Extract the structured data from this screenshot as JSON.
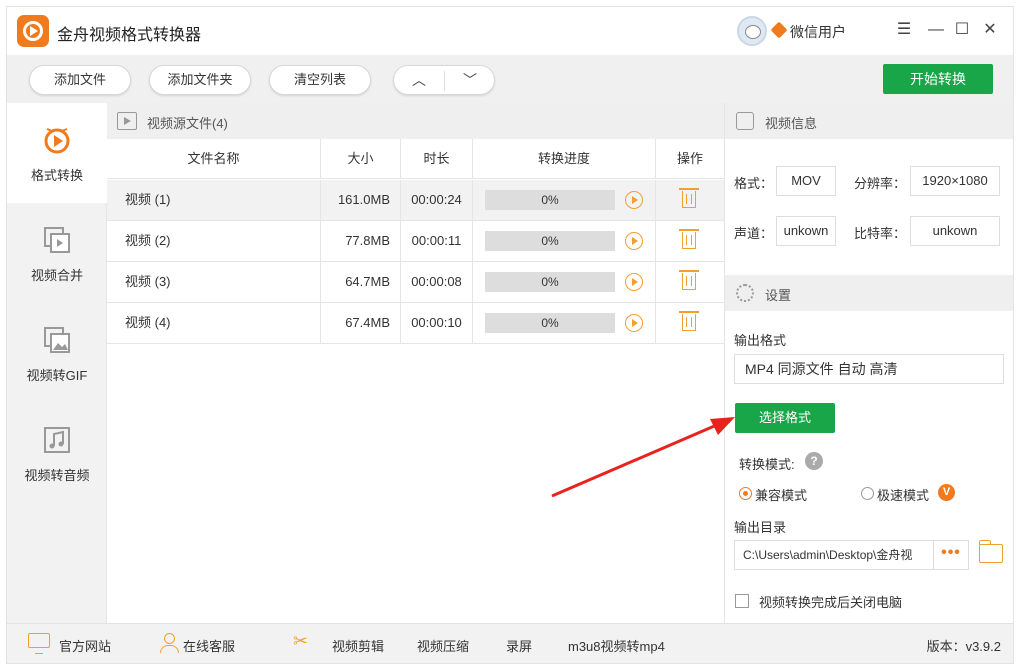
{
  "app": {
    "title": "金舟视频格式转换器",
    "user_name": "微信用户"
  },
  "window_controls": {
    "menu": "☰",
    "minimize": "—",
    "maximize": "☐",
    "close": "✕"
  },
  "toolbar": {
    "add_file": "添加文件",
    "add_folder": "添加文件夹",
    "clear_list": "清空列表",
    "move_up": "︿",
    "move_down": "﹀",
    "start": "开始转换"
  },
  "sidebar": {
    "items": [
      {
        "label": "格式转换",
        "icon": "format-convert-icon",
        "active": true
      },
      {
        "label": "视频合并",
        "icon": "video-merge-icon",
        "active": false
      },
      {
        "label": "视频转GIF",
        "icon": "video-to-gif-icon",
        "active": false
      },
      {
        "label": "视频转音频",
        "icon": "video-to-audio-icon",
        "active": false
      }
    ]
  },
  "files": {
    "header": "视频源文件(4)",
    "columns": [
      "文件名称",
      "大小",
      "时长",
      "转换进度",
      "操作"
    ],
    "rows": [
      {
        "name": "视频 (1)",
        "size": "161.0MB",
        "duration": "00:00:24",
        "progress": "0%",
        "selected": true
      },
      {
        "name": "视频 (2)",
        "size": "77.8MB",
        "duration": "00:00:11",
        "progress": "0%",
        "selected": false
      },
      {
        "name": "视频 (3)",
        "size": "64.7MB",
        "duration": "00:00:08",
        "progress": "0%",
        "selected": false
      },
      {
        "name": "视频 (4)",
        "size": "67.4MB",
        "duration": "00:00:10",
        "progress": "0%",
        "selected": false
      }
    ]
  },
  "video_info": {
    "header": "视频信息",
    "format_label": "格式：",
    "format_value": "MOV",
    "resolution_label": "分辨率：",
    "resolution_value": "1920×1080",
    "channel_label": "声道：",
    "channel_value": "unkown",
    "bitrate_label": "比特率：",
    "bitrate_value": "unkown"
  },
  "settings": {
    "header": "设置",
    "output_format_label": "输出格式",
    "output_format_value": "MP4 同源文件 自动 高清",
    "choose_format": "选择格式",
    "mode_label": "转换模式:",
    "help": "?",
    "mode_compat": "兼容模式",
    "mode_fast": "极速模式",
    "vip_badge": "V",
    "output_dir_label": "输出目录",
    "output_dir_value": "C:\\Users\\admin\\Desktop\\金舟视",
    "browse": "•••",
    "shutdown_label": "视频转换完成后关闭电脑"
  },
  "bottom": {
    "official_site": "官方网站",
    "online_service": "在线客服",
    "video_edit": "视频剪辑",
    "video_compress": "视频压缩",
    "screen_record": "录屏",
    "m3u8": "m3u8视频转mp4",
    "version": "版本：v3.9.2"
  },
  "colors": {
    "accent_orange": "#f07a1e",
    "green": "#19a649",
    "annotation_red": "#e8231e"
  }
}
